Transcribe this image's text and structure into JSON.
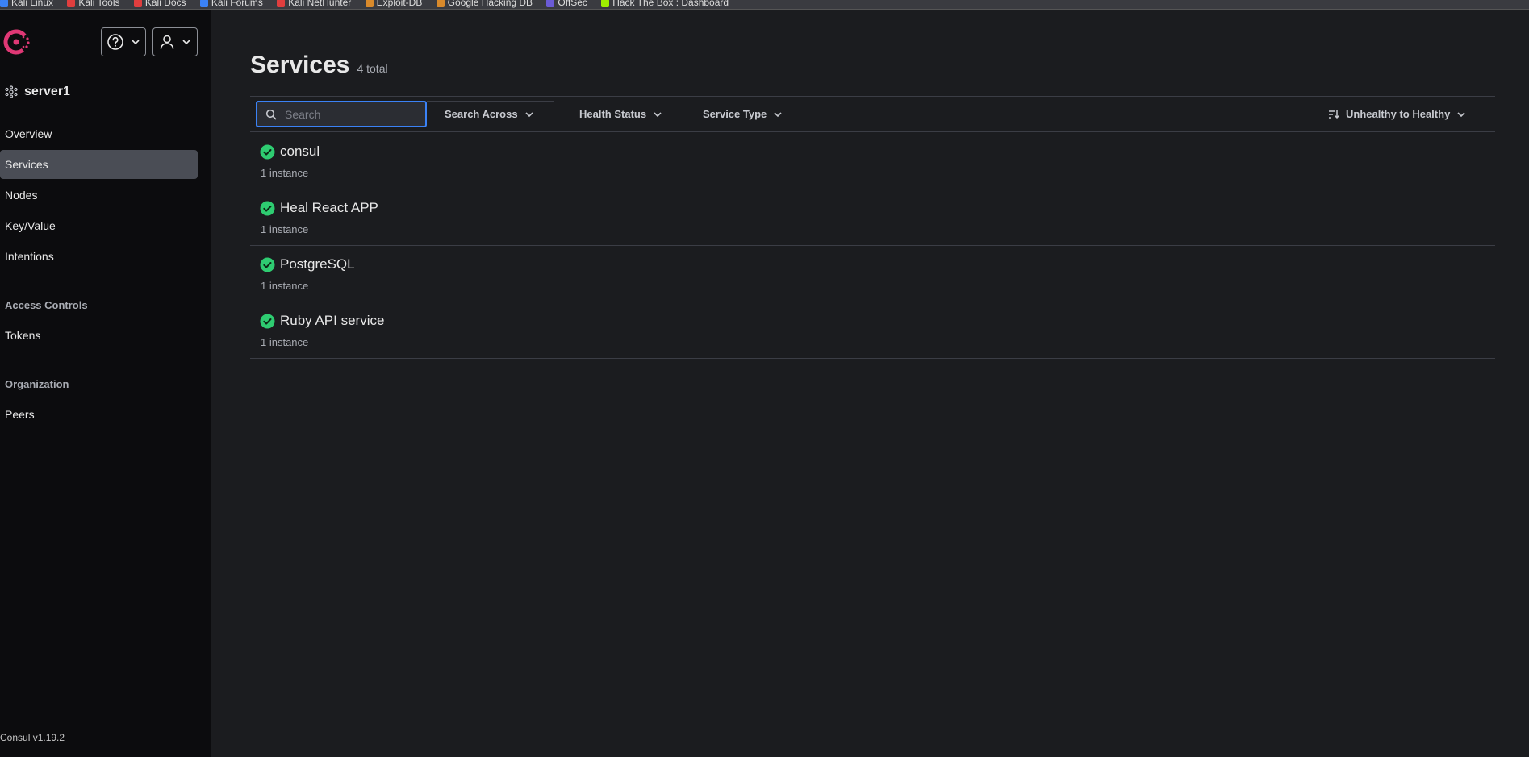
{
  "bookmarks": [
    "Kali Linux",
    "Kali Tools",
    "Kali Docs",
    "Kali Forums",
    "Kali NetHunter",
    "Exploit-DB",
    "Google Hacking DB",
    "OffSec",
    "Hack The Box : Dashboard"
  ],
  "colors": {
    "brand": "#e03875",
    "accent": "#3b82f6",
    "healthy": "#2ecc71",
    "active_nav": "#4a4d55"
  },
  "header": {
    "help_icon": "help-icon",
    "user_icon": "user-icon"
  },
  "sidebar": {
    "datacenter": "server1",
    "items": [
      {
        "label": "Overview",
        "active": false
      },
      {
        "label": "Services",
        "active": true
      },
      {
        "label": "Nodes",
        "active": false
      },
      {
        "label": "Key/Value",
        "active": false
      },
      {
        "label": "Intentions",
        "active": false
      }
    ],
    "access_controls": {
      "heading": "Access Controls",
      "items": [
        {
          "label": "Tokens"
        }
      ]
    },
    "organization": {
      "heading": "Organization",
      "items": [
        {
          "label": "Peers"
        }
      ]
    },
    "version": "Consul v1.19.2"
  },
  "page": {
    "title": "Services",
    "count": "4 total"
  },
  "filters": {
    "search_placeholder": "Search",
    "search_value": "",
    "search_across": "Search Across",
    "health_status": "Health Status",
    "service_type": "Service Type",
    "sort": "Unhealthy to Healthy"
  },
  "services": [
    {
      "name": "consul",
      "instances": "1 instance",
      "status": "healthy"
    },
    {
      "name": "Heal React APP",
      "instances": "1 instance",
      "status": "healthy"
    },
    {
      "name": "PostgreSQL",
      "instances": "1 instance",
      "status": "healthy"
    },
    {
      "name": "Ruby API service",
      "instances": "1 instance",
      "status": "healthy"
    }
  ]
}
